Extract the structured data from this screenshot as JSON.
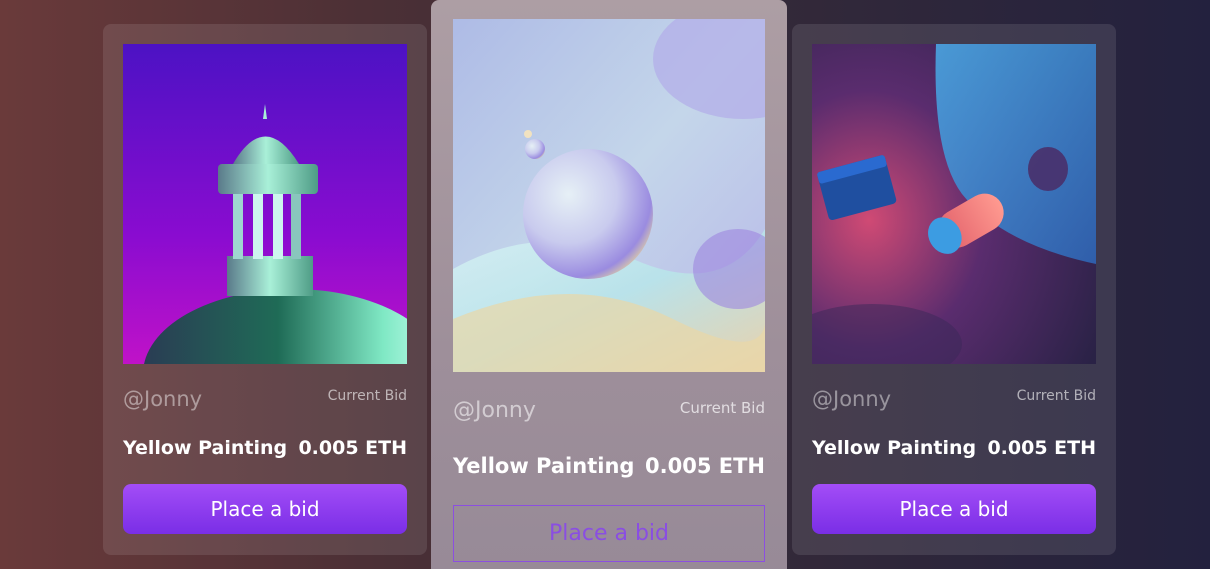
{
  "cards": [
    {
      "handle": "@Jonny",
      "bid_label": "Current Bid",
      "title": "Yellow Painting",
      "price": "0.005 ETH",
      "button_label": "Place a bid",
      "art_icon": "tower-dome-artwork"
    },
    {
      "handle": "@Jonny",
      "bid_label": "Current Bid",
      "title": "Yellow Painting",
      "price": "0.005 ETH",
      "button_label": "Place a bid",
      "art_icon": "planet-spheres-artwork"
    },
    {
      "handle": "@Jonny",
      "bid_label": "Current Bid",
      "title": "Yellow Painting",
      "price": "0.005 ETH",
      "button_label": "Place a bid",
      "art_icon": "floating-shapes-artwork"
    }
  ],
  "colors": {
    "accent": "#8a4ee2",
    "button_gradient_top": "#a34df7",
    "button_gradient_bottom": "#7a2ee6"
  }
}
